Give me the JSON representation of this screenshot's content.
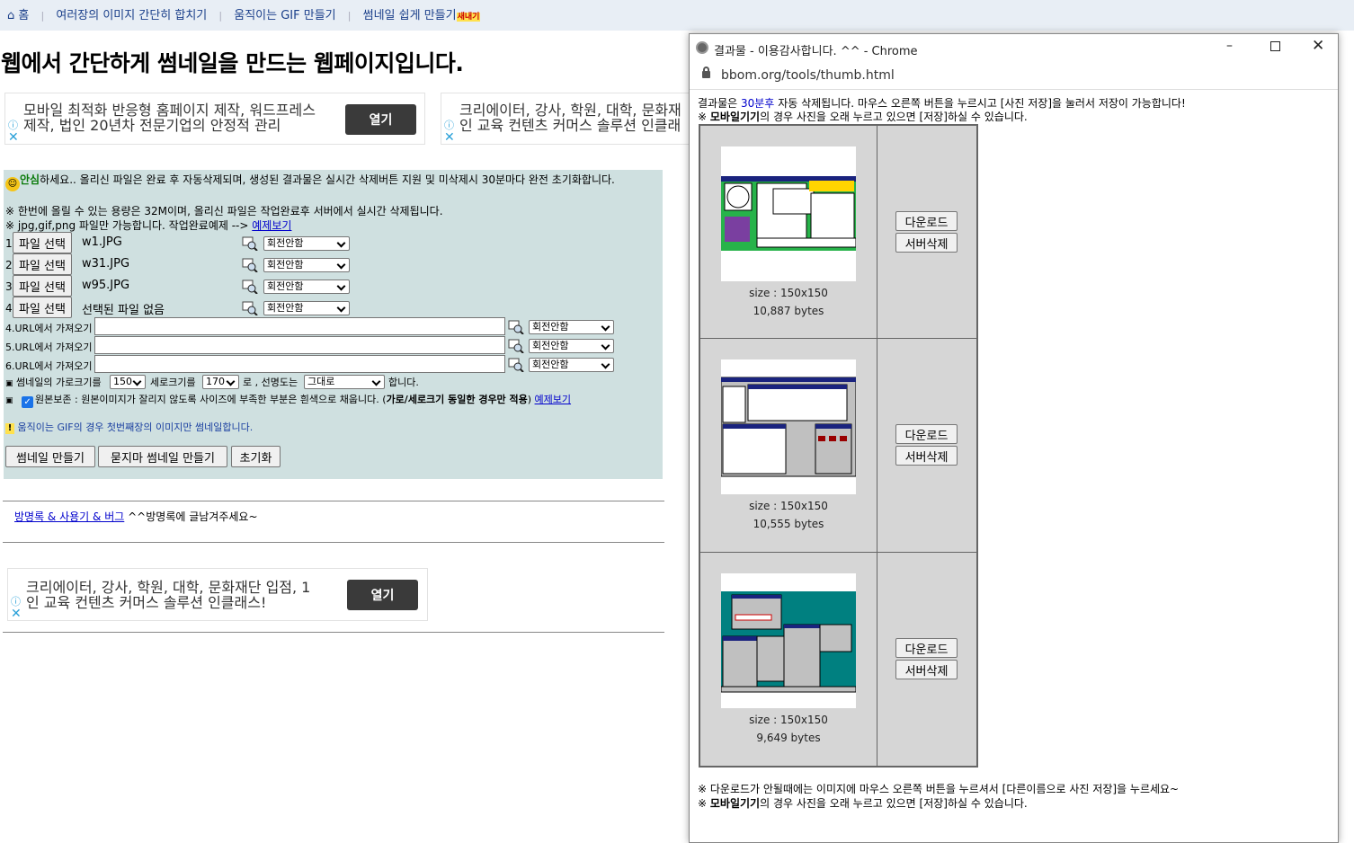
{
  "nav": {
    "home": "홈",
    "links": [
      "여러장의 이미지 간단히 합치기",
      "움직이는 GIF 만들기",
      "썸네일 쉽게 만들기"
    ],
    "new_badge": "새내기"
  },
  "page_title": "웹에서 간단하게 썸네일을 만드는 웹페이지입니다.",
  "ads": [
    {
      "text": "모바일 최적화 반응형 홈페이지 제작, 워드프레스\n제작, 법인 20년차 전문기업의 안정적 관리",
      "button": "열기"
    },
    {
      "text": "크리에이터, 강사, 학원, 대학, 문화재\n인 교육 컨텐츠 커머스 솔루션 인클래"
    },
    {
      "text": "크리에이터, 강사, 학원, 대학, 문화재단 입점, 1\n인 교육 컨텐츠 커머스 솔루션 인클래스!",
      "button": "열기"
    }
  ],
  "form": {
    "notice_highlight": "안심",
    "notice_text": "하세요.. 올리신 파일은 완료 후 자동삭제되며, 생성된 결과물은 실시간 삭제버튼 지원 및 미삭제시 30분마다 완전 초기화합니다.",
    "capacity_note": "※ 한번에 올릴 수 있는 용량은 32M이며, 올리신 파일은 작업완료후 서버에서 실시간 삭제됩니다.",
    "type_note": "※ jpg,gif,png 파일만 가능합니다. 작업완료예제 -->",
    "example_link": "예제보기",
    "file_button": "파일 선택",
    "files": [
      {
        "num": "1.",
        "name": "w1.JPG",
        "rotate": "회전안함"
      },
      {
        "num": "2.",
        "name": "w31.JPG",
        "rotate": "회전안함"
      },
      {
        "num": "3.",
        "name": "w95.JPG",
        "rotate": "회전안함"
      },
      {
        "num": "4.",
        "name": "선택된 파일 없음",
        "rotate": "회전안함"
      }
    ],
    "urls": [
      {
        "label": "4.URL에서 가져오기",
        "value": "",
        "rotate": "회전안함"
      },
      {
        "label": "5.URL에서 가져오기",
        "value": "",
        "rotate": "회전안함"
      },
      {
        "label": "6.URL에서 가져오기",
        "value": "",
        "rotate": "회전안함"
      }
    ],
    "size_prefix": "썸네일의 가로크기를",
    "width_value": "150",
    "size_mid": "세로크기를",
    "height_value": "170",
    "size_mid2": "로 , 선명도는",
    "sharpness_value": "그대로",
    "size_suffix": "합니다.",
    "preserve_text": "원본보존 : 원본이미지가 잘리지 않도록 사이즈에 부족한 부분은 흰색으로 채웁니다. (",
    "preserve_bold": "가로/세로크기 동일한 경우만 적용",
    "preserve_close": ")",
    "preserve_link": "예제보기",
    "preserve_checked": true,
    "gif_notice": "움직이는 GIF의 경우 첫번째장의 이미지만 썸네일합니다.",
    "buttons": [
      "썸네일 만들기",
      "묻지마 썸네일 만들기",
      "초기화"
    ]
  },
  "guestbook": {
    "link": "방명록 & 사용기 & 버그",
    "text": "^^방명록에 글남겨주세요~"
  },
  "popup": {
    "window_title": "결과물 - 이용감사합니다. ^^ - Chrome",
    "url": "bbom.org/tools/thumb.html",
    "notice_pre": "결과물은",
    "notice_highlight": "30분후",
    "notice_post": "자동 삭제됩니다. 마우스 오른쪽 버튼을 누르시고 [사진 저장]을 눌러서 저장이 가능합니다!",
    "mobile_prefix": "※",
    "mobile_bold": "모바일기기",
    "mobile_text": "의 경우 사진을 오래 누르고 있으면 [저장]하실 수 있습니다.",
    "results": [
      {
        "size": "size : 150x150",
        "bytes": "10,887 bytes",
        "download": "다운로드",
        "delete": "서버삭제"
      },
      {
        "size": "size : 150x150",
        "bytes": "10,555 bytes",
        "download": "다운로드",
        "delete": "서버삭제"
      },
      {
        "size": "size : 150x150",
        "bytes": "9,649 bytes",
        "download": "다운로드",
        "delete": "서버삭제"
      }
    ],
    "footer_note": "※ 다운로드가 안될때에는 이미지에 마우스 오른쪽 버튼을 누르셔서 [다른이름으로 사진 저장]을 누르세요~"
  }
}
